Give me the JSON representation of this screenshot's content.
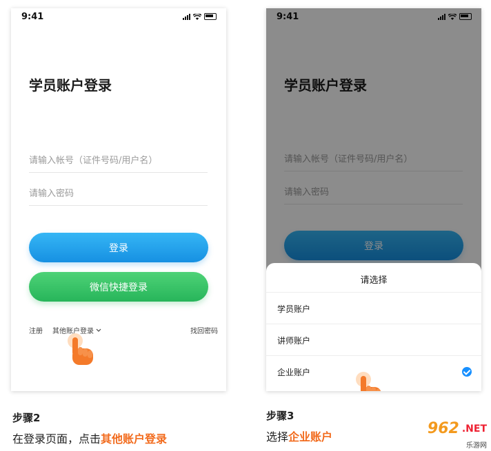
{
  "left_screen": {
    "status_time": "9:41",
    "title": "学员账户登录",
    "account_placeholder": "请输入帐号（证件号码/用户名）",
    "password_placeholder": "请输入密码",
    "login_button": "登录",
    "wechat_button": "微信快捷登录",
    "register_link": "注册",
    "other_account_link": "其他账户登录",
    "forgot_password_link": "找回密码"
  },
  "right_screen": {
    "status_time": "9:41",
    "title": "学员账户登录",
    "account_placeholder": "请输入帐号（证件号码/用户名）",
    "password_placeholder": "请输入密码",
    "login_button": "登录",
    "sheet": {
      "title": "请选择",
      "items": [
        {
          "label": "学员账户",
          "selected": false
        },
        {
          "label": "讲师账户",
          "selected": false
        },
        {
          "label": "企业账户",
          "selected": true
        }
      ]
    }
  },
  "captions": {
    "step2": {
      "step": "步骤2",
      "prefix": "在登录页面，点击",
      "highlight": "其他账户登录"
    },
    "step3": {
      "step": "步骤3",
      "prefix": "选择",
      "highlight": "企业账户"
    }
  },
  "watermark": {
    "number": "962",
    "net": ".NET",
    "sub": "乐游网"
  },
  "colors": {
    "primary_blue": "#1a96e8",
    "wechat_green": "#2fc060",
    "highlight_orange": "#f26b1d",
    "check_blue": "#1890ff"
  },
  "icons": [
    "signal-icon",
    "wifi-icon",
    "battery-icon",
    "chevron-down-icon",
    "pointing-hand-icon",
    "check-icon"
  ]
}
